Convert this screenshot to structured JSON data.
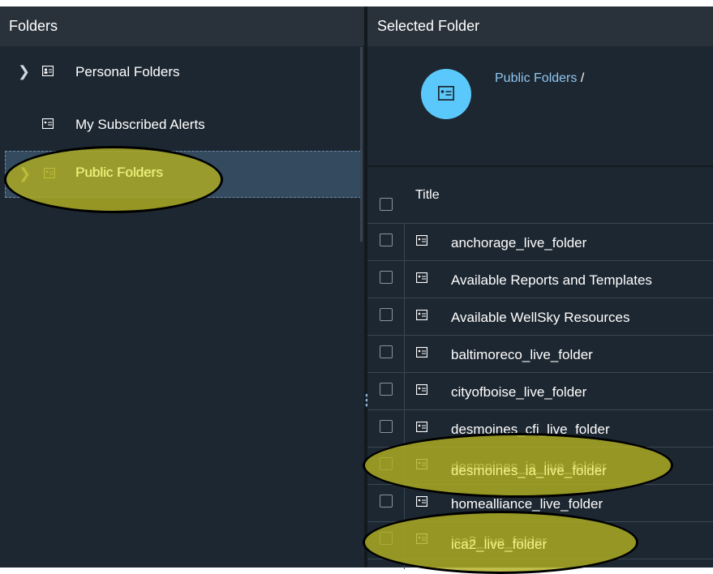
{
  "left_panel": {
    "header": "Folders",
    "items": [
      {
        "label": "Personal Folders",
        "icon": "contact-folder-icon",
        "expandable": true
      },
      {
        "label": "My Subscribed Alerts",
        "icon": "folder-icon",
        "expandable": false
      },
      {
        "label": "Public Folders",
        "icon": "folder-icon",
        "expandable": true,
        "selected": true
      }
    ]
  },
  "right_panel": {
    "header": "Selected Folder",
    "breadcrumb": {
      "folder": "Public Folders",
      "separator": "/"
    },
    "table": {
      "column_title": "Title",
      "rows": [
        "anchorage_live_folder",
        "Available Reports and Templates",
        "Available WellSky Resources",
        "baltimoreco_live_folder",
        "cityofboise_live_folder",
        "desmoines_cfi_live_folder",
        "desmoines_ia_live_folder",
        "homealliance_live_folder",
        "ica2_live_folder"
      ]
    }
  },
  "colors": {
    "background": "#1d2731",
    "header": "#29313a",
    "selected": "#344a5f",
    "accent": "#5ac8fa",
    "highlight": "#b0ae22"
  }
}
